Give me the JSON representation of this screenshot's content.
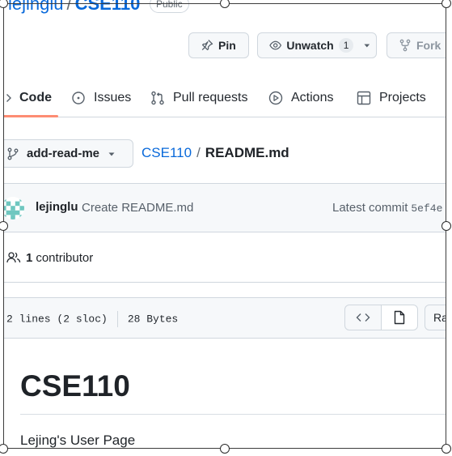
{
  "repo": {
    "owner": "lejinglu",
    "separator": "/",
    "name": "CSE110",
    "visibility": "Public"
  },
  "actions": {
    "pin_label": "Pin",
    "watch_label": "Unwatch",
    "watch_count": "1",
    "fork_label": "Fork"
  },
  "tabs": [
    {
      "label": "Code",
      "icon": "code-icon",
      "active": true
    },
    {
      "label": "Issues",
      "icon": "issue-icon"
    },
    {
      "label": "Pull requests",
      "icon": "pull-request-icon"
    },
    {
      "label": "Actions",
      "icon": "play-icon"
    },
    {
      "label": "Projects",
      "icon": "table-icon"
    }
  ],
  "branch": {
    "name": "add-read-me"
  },
  "breadcrumb": {
    "root": "CSE110",
    "separator": "/",
    "file": "README.md"
  },
  "commit": {
    "author": "lejinglu",
    "message": "Create README.md",
    "latest_label": "Latest commit",
    "sha": "5ef4e"
  },
  "contributors": {
    "count": "1",
    "label": "contributor"
  },
  "file": {
    "lines": "2 lines (2 sloc)",
    "size": "28 Bytes",
    "raw_label": "Raw"
  },
  "readme": {
    "heading": "CSE110",
    "text": "Lejing's User Page"
  },
  "colors": {
    "link": "#0969da",
    "active_tab_underline": "#fd8c73",
    "border": "#d0d7de",
    "subtle_bg": "#f6f8fa"
  }
}
